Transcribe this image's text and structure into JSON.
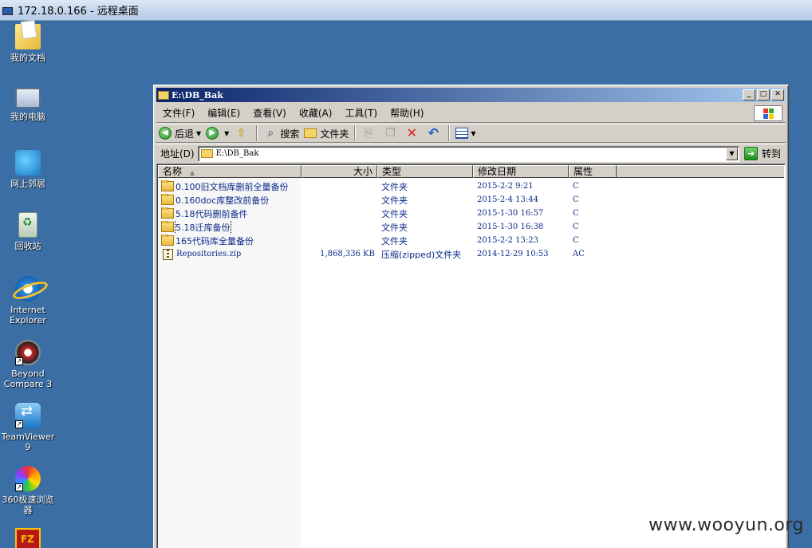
{
  "rdp": {
    "title": "172.18.0.166 - 远程桌面"
  },
  "desktop": {
    "icons": [
      {
        "label": "我的文档"
      },
      {
        "label": "我的电脑"
      },
      {
        "label": "网上邻居"
      },
      {
        "label": "回收站"
      },
      {
        "label": "Internet Explorer"
      },
      {
        "label": "Beyond Compare 3"
      },
      {
        "label": "TeamViewer 9"
      },
      {
        "label": "360极速浏览器"
      }
    ]
  },
  "window": {
    "title": "E:\\DB_Bak",
    "menu": [
      "文件(F)",
      "编辑(E)",
      "查看(V)",
      "收藏(A)",
      "工具(T)",
      "帮助(H)"
    ],
    "toolbar": {
      "back": "后退",
      "search": "搜索",
      "folders": "文件夹"
    },
    "address": {
      "label": "地址(D)",
      "value": "E:\\DB_Bak",
      "go": "转到"
    },
    "columns": {
      "name": "名称",
      "size": "大小",
      "type": "类型",
      "modified": "修改日期",
      "attributes": "属性"
    },
    "files": [
      {
        "name": "0.100旧文档库删前全量备份",
        "size": "",
        "type": "文件夹",
        "modified": "2015-2-2 9:21",
        "attr": "C",
        "kind": "folder"
      },
      {
        "name": "0.160doc库整改前备份",
        "size": "",
        "type": "文件夹",
        "modified": "2015-2-4 13:44",
        "attr": "C",
        "kind": "folder"
      },
      {
        "name": "5.18代码删前备件",
        "size": "",
        "type": "文件夹",
        "modified": "2015-1-30 16:57",
        "attr": "C",
        "kind": "folder"
      },
      {
        "name": "5.18迁库备份",
        "size": "",
        "type": "文件夹",
        "modified": "2015-1-30 16:38",
        "attr": "C",
        "kind": "folder"
      },
      {
        "name": "165代码库全量备份",
        "size": "",
        "type": "文件夹",
        "modified": "2015-2-2 13:23",
        "attr": "C",
        "kind": "folder"
      },
      {
        "name": "Repositories.zip",
        "size": "1,868,336 KB",
        "type": "压缩(zipped)文件夹",
        "modified": "2014-12-29 10:53",
        "attr": "AC",
        "kind": "zip"
      }
    ]
  },
  "watermark": "www.wooyun.org"
}
